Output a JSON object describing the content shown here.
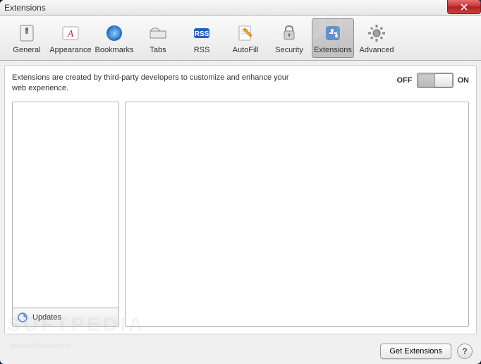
{
  "window": {
    "title": "Extensions"
  },
  "toolbar": {
    "items": [
      {
        "label": "General",
        "icon": "general"
      },
      {
        "label": "Appearance",
        "icon": "appearance"
      },
      {
        "label": "Bookmarks",
        "icon": "bookmarks"
      },
      {
        "label": "Tabs",
        "icon": "tabs"
      },
      {
        "label": "RSS",
        "icon": "rss"
      },
      {
        "label": "AutoFill",
        "icon": "autofill"
      },
      {
        "label": "Security",
        "icon": "security"
      },
      {
        "label": "Extensions",
        "icon": "extensions",
        "selected": true
      },
      {
        "label": "Advanced",
        "icon": "advanced"
      }
    ]
  },
  "content": {
    "description": "Extensions are created by third-party developers to customize and enhance your web experience.",
    "toggle": {
      "off_label": "OFF",
      "on_label": "ON",
      "state": "off"
    },
    "updates_label": "Updates"
  },
  "footer": {
    "get_extensions_label": "Get Extensions",
    "help_label": "?"
  }
}
